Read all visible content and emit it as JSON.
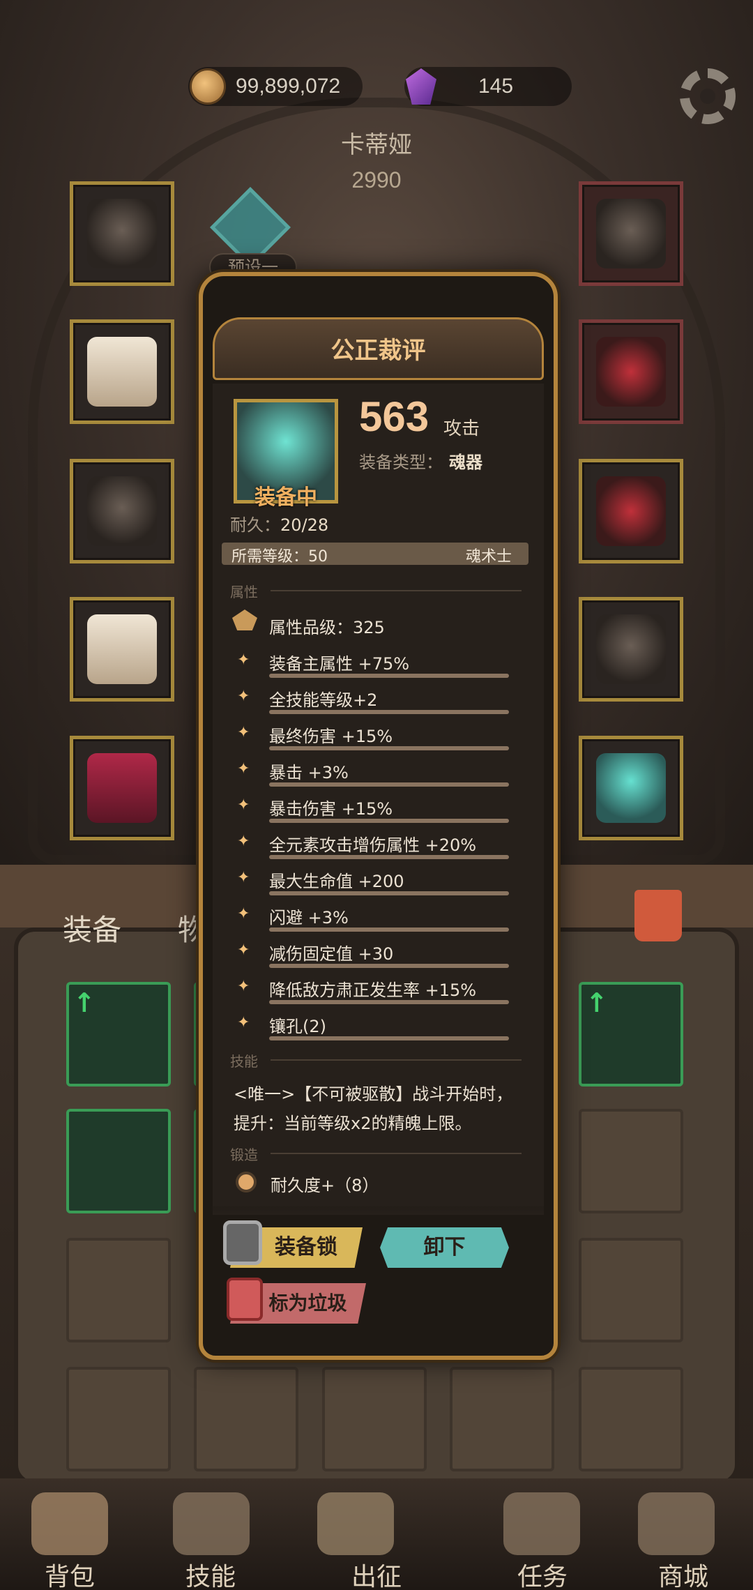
{
  "topbar": {
    "gold": "99,899,072",
    "gems": "145"
  },
  "character": {
    "name": "卡蒂娅",
    "power": "2990",
    "preset": "预设一"
  },
  "tabs": {
    "equipment": "装备",
    "items": "物品"
  },
  "modal": {
    "title": "公正裁评",
    "attack_value": "563",
    "attack_unit": "攻击",
    "type_label": "装备类型：",
    "type_value": "魂器",
    "equipped_label": "装备中",
    "durability_label": "耐久：",
    "durability_value": "20/28",
    "requirement": "所需等级：50",
    "class": "魂术士",
    "section_attributes": "属性",
    "grade": "属性品级：325",
    "attributes": [
      "装备主属性 +75%",
      "全技能等级+2",
      "最终伤害 +15%",
      "暴击 +3%",
      "暴击伤害 +15%",
      "全元素攻击增伤属性 +20%",
      "最大生命值 +200",
      "闪避 +3%",
      "减伤固定值 +30",
      "降低敌方肃正发生率 +15%",
      "镶孔(2)"
    ],
    "section_skill": "技能",
    "skill_text": "<唯一>【不可被驱散】战斗开始时，提升：当前等级x2的精魄上限。",
    "section_forge": "锻造",
    "forge_item": "耐久度+（8）",
    "buttons": {
      "lock": "装备锁",
      "unequip": "卸下",
      "mark_trash": "标为垃圾"
    }
  },
  "nav": {
    "bag": "背包",
    "skills": "技能",
    "expedition": "出征",
    "quests": "任务",
    "shop": "商城"
  },
  "icons": [
    "coin-icon",
    "gem-icon",
    "gear-icon",
    "preset-icon",
    "trash-icon",
    "lock-icon",
    "star-icon"
  ],
  "colors": {
    "accent_gold": "#b4843c",
    "title": "#f0c58a",
    "unequip_button": "#5fbab2",
    "lock_button": "#d9b75a",
    "trash_button": "#c26a6a",
    "upgrade_green": "#45d26e"
  }
}
